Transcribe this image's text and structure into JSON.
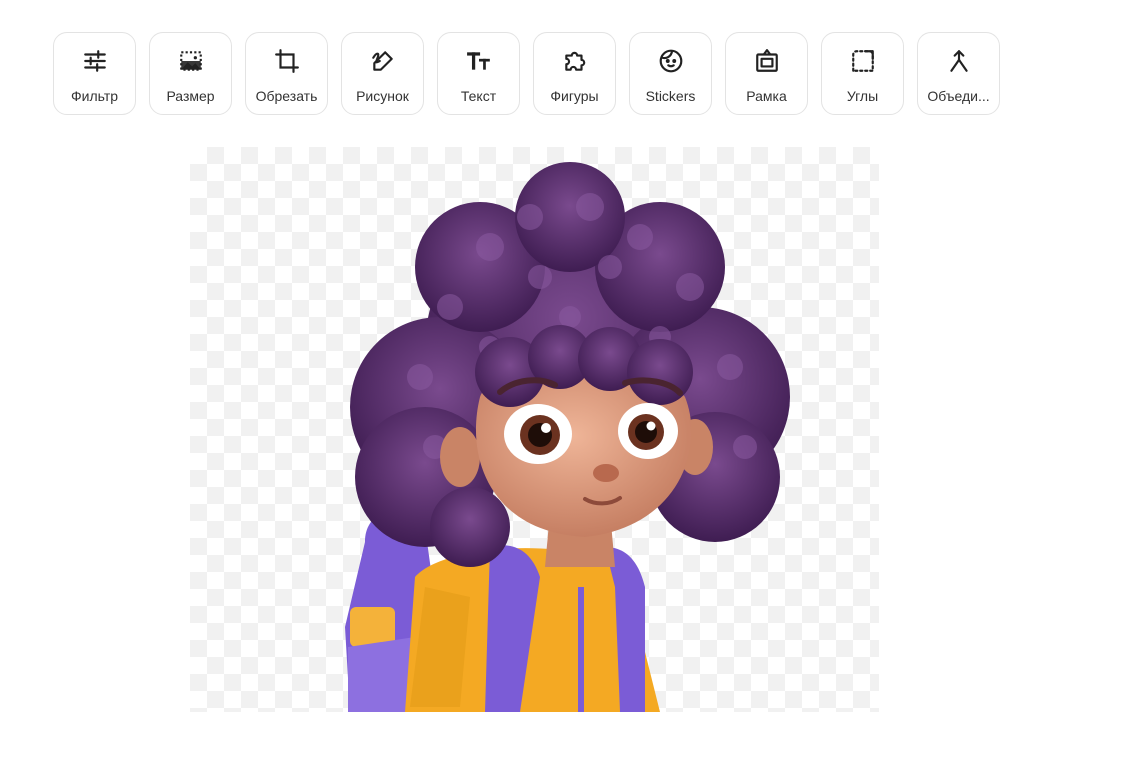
{
  "toolbar": {
    "tools": [
      {
        "label": "Фильтр",
        "icon": "sliders-icon"
      },
      {
        "label": "Размер",
        "icon": "resize-image-icon"
      },
      {
        "label": "Обрезать",
        "icon": "crop-icon"
      },
      {
        "label": "Рисунок",
        "icon": "draw-pen-icon"
      },
      {
        "label": "Текст",
        "icon": "text-icon"
      },
      {
        "label": "Фигуры",
        "icon": "puzzle-shape-icon"
      },
      {
        "label": "Stickers",
        "icon": "sticker-face-icon"
      },
      {
        "label": "Рамка",
        "icon": "frame-icon"
      },
      {
        "label": "Углы",
        "icon": "corners-icon"
      },
      {
        "label": "Объеди...",
        "icon": "merge-icon"
      }
    ]
  },
  "canvas": {
    "image": "cartoon-child-with-purple-curly-hair-and-backpack",
    "background": "transparent-checkerboard"
  },
  "colors": {
    "hair": "#5b2f6e",
    "jacket": "#f4a923",
    "backpack": "#7b5cd6",
    "skin": "#d9987e"
  }
}
